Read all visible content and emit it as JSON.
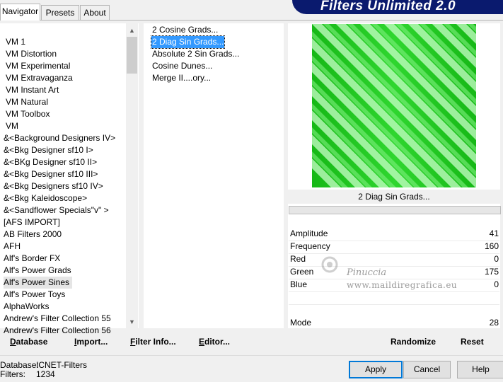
{
  "tabs": [
    "Navigator",
    "Presets",
    "About"
  ],
  "banner_title": "Filters Unlimited 2.0",
  "categories": [
    "VM 1",
    "VM Distortion",
    "VM Experimental",
    "VM Extravaganza",
    "VM Instant Art",
    "VM Natural",
    "VM Toolbox",
    "VM",
    "&<Background Designers IV>",
    "&<Bkg Designer sf10 I>",
    "&<BKg Designer sf10 II>",
    "&<Bkg Designer sf10 III>",
    "&<Bkg Designers sf10 IV>",
    "&<Bkg Kaleidoscope>",
    "&<Sandflower Specials\"v\" >",
    "[AFS IMPORT]",
    "AB Filters 2000",
    "AFH",
    "Alf's Border FX",
    "Alf's Power Grads",
    "Alf's Power Sines",
    "Alf's Power Toys",
    "AlphaWorks",
    "Andrew's Filter Collection 55",
    "Andrew's Filter Collection 56"
  ],
  "selected_category": "Alf's Power Sines",
  "filters": [
    "2 Cosine Grads...",
    "2 Diag Sin Grads...",
    "Absolute 2 Sin Grads...",
    "Cosine Dunes...",
    "Merge II....ory..."
  ],
  "selected_filter": "2 Diag Sin Grads...",
  "filter_name": "2 Diag Sin Grads...",
  "params": [
    {
      "label": "Amplitude",
      "value": "41"
    },
    {
      "label": "Frequency",
      "value": "160"
    },
    {
      "label": "Red",
      "value": "0"
    },
    {
      "label": "Green",
      "value": "175"
    },
    {
      "label": "Blue",
      "value": "0"
    },
    {
      "label": "Mode",
      "value": "28"
    }
  ],
  "toolbar": {
    "database_first": "D",
    "database_rest": "atabase",
    "import_first": "I",
    "import_rest": "mport...",
    "filterinfo_first": "F",
    "filterinfo_rest": "ilter Info...",
    "editor_first": "E",
    "editor_rest": "ditor...",
    "randomize": "Randomize",
    "reset": "Reset"
  },
  "status": {
    "database_label": "Database:",
    "database_value": "ICNET-Filters",
    "filters_label": "Filters:",
    "filters_value": "1234"
  },
  "buttons": {
    "apply": "Apply",
    "cancel": "Cancel",
    "help": "Help"
  },
  "watermark": {
    "name": "Pinuccia",
    "site": "www.maildiregrafica.eu"
  },
  "colors": {
    "preview_green": "#1ec81e",
    "selection_blue": "#3399ff",
    "banner_navy": "#0a1a6e"
  }
}
